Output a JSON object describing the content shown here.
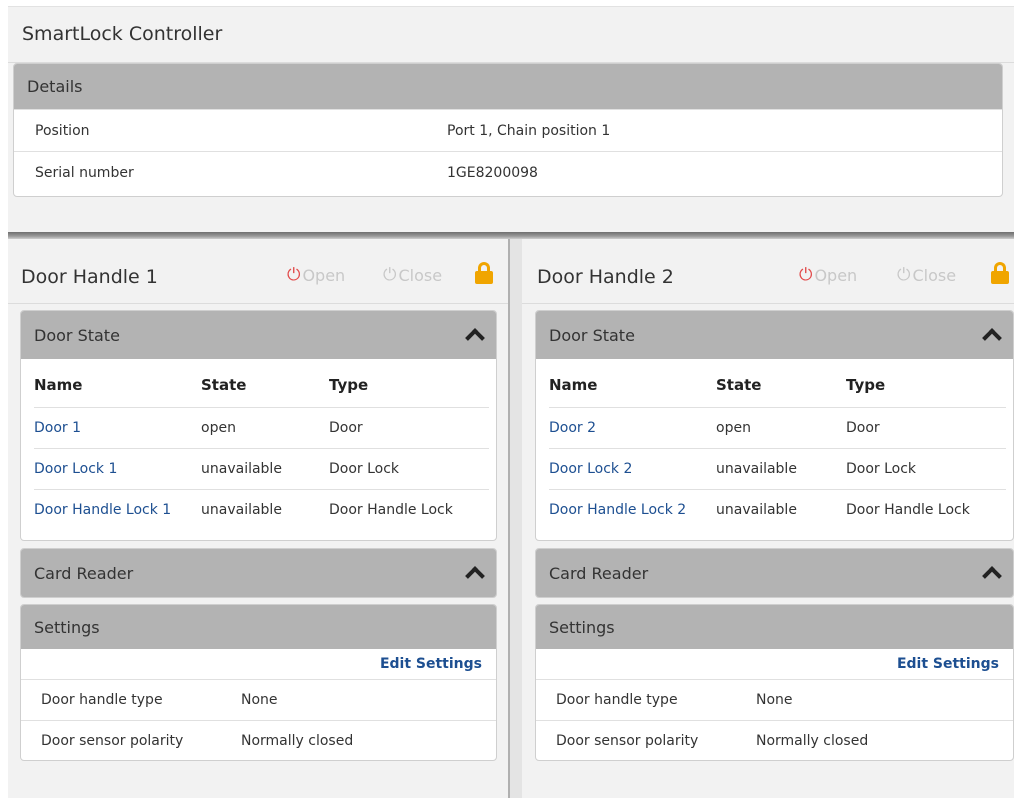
{
  "app": {
    "title": "SmartLock Controller"
  },
  "details": {
    "header": "Details",
    "rows": [
      {
        "key": "Position",
        "value": "Port 1, Chain position 1"
      },
      {
        "key": "Serial number",
        "value": "1GE8200098"
      }
    ]
  },
  "panels": [
    {
      "title": "Door Handle 1",
      "open_label": "Open",
      "close_label": "Close",
      "door_state": {
        "header": "Door State",
        "columns": [
          "Name",
          "State",
          "Type"
        ],
        "rows": [
          {
            "name": "Door 1",
            "state": "open",
            "type": "Door"
          },
          {
            "name": "Door Lock 1",
            "state": "unavailable",
            "type": "Door Lock"
          },
          {
            "name": "Door Handle Lock 1",
            "state": "unavailable",
            "type": "Door Handle Lock"
          }
        ]
      },
      "card_reader": {
        "header": "Card Reader"
      },
      "settings": {
        "header": "Settings",
        "edit_label": "Edit Settings",
        "rows": [
          {
            "key": "Door handle type",
            "value": "None"
          },
          {
            "key": "Door sensor polarity",
            "value": "Normally closed"
          }
        ]
      }
    },
    {
      "title": "Door Handle 2",
      "open_label": "Open",
      "close_label": "Close",
      "door_state": {
        "header": "Door State",
        "columns": [
          "Name",
          "State",
          "Type"
        ],
        "rows": [
          {
            "name": "Door 2",
            "state": "open",
            "type": "Door"
          },
          {
            "name": "Door Lock 2",
            "state": "unavailable",
            "type": "Door Lock"
          },
          {
            "name": "Door Handle Lock 2",
            "state": "unavailable",
            "type": "Door Handle Lock"
          }
        ]
      },
      "card_reader": {
        "header": "Card Reader"
      },
      "settings": {
        "header": "Settings",
        "edit_label": "Edit Settings",
        "rows": [
          {
            "key": "Door handle type",
            "value": "None"
          },
          {
            "key": "Door sensor polarity",
            "value": "Normally closed"
          }
        ]
      }
    }
  ],
  "icons": {
    "open": "power-icon",
    "close": "power-icon",
    "lock": "lock-icon",
    "collapse": "chevron-up-icon"
  },
  "colors": {
    "link": "#1d4f91",
    "open_icon": "#e24b4b",
    "lock_icon": "#f0a500",
    "header_bg": "#b3b3b3"
  }
}
